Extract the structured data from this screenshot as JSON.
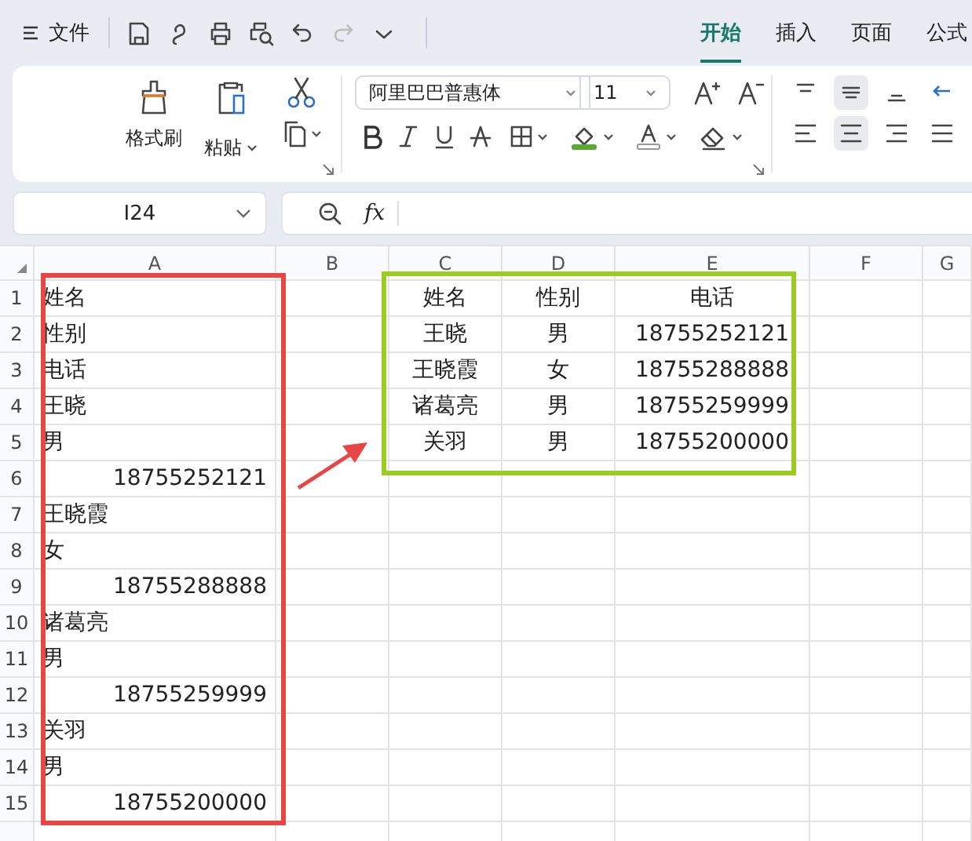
{
  "menu": {
    "label": "文件"
  },
  "tabs": [
    {
      "label": "开始",
      "selected": true
    },
    {
      "label": "插入",
      "selected": false
    },
    {
      "label": "页面",
      "selected": false
    },
    {
      "label": "公式",
      "selected": false
    }
  ],
  "ribbon": {
    "format_painter": "格式刷",
    "paste": "粘贴",
    "font_name": "阿里巴巴普惠体",
    "font_size": "11"
  },
  "formula_bar": {
    "cell_ref": "I24",
    "fx": "fx"
  },
  "sheet": {
    "columns": [
      "A",
      "B",
      "C",
      "D",
      "E",
      "F",
      "G"
    ],
    "rows": [
      {
        "number": "1",
        "cells": [
          "姓名",
          "",
          "姓名",
          "性别",
          "电话",
          "",
          ""
        ]
      },
      {
        "number": "2",
        "cells": [
          "性别",
          "",
          "王晓",
          "男",
          "18755252121",
          "",
          ""
        ]
      },
      {
        "number": "3",
        "cells": [
          "电话",
          "",
          "王晓霞",
          "女",
          "18755288888",
          "",
          ""
        ]
      },
      {
        "number": "4",
        "cells": [
          "王晓",
          "",
          "诸葛亮",
          "男",
          "18755259999",
          "",
          ""
        ]
      },
      {
        "number": "5",
        "cells": [
          "男",
          "",
          "关羽",
          "男",
          "18755200000",
          "",
          ""
        ]
      },
      {
        "number": "6",
        "cells": [
          "18755252121",
          "",
          "",
          "",
          "",
          "",
          ""
        ]
      },
      {
        "number": "7",
        "cells": [
          "王晓霞",
          "",
          "",
          "",
          "",
          "",
          ""
        ]
      },
      {
        "number": "8",
        "cells": [
          "女",
          "",
          "",
          "",
          "",
          "",
          ""
        ]
      },
      {
        "number": "9",
        "cells": [
          "18755288888",
          "",
          "",
          "",
          "",
          "",
          ""
        ]
      },
      {
        "number": "10",
        "cells": [
          "诸葛亮",
          "",
          "",
          "",
          "",
          "",
          ""
        ]
      },
      {
        "number": "11",
        "cells": [
          "男",
          "",
          "",
          "",
          "",
          "",
          ""
        ]
      },
      {
        "number": "12",
        "cells": [
          "18755259999",
          "",
          "",
          "",
          "",
          "",
          ""
        ]
      },
      {
        "number": "13",
        "cells": [
          "关羽",
          "",
          "",
          "",
          "",
          "",
          ""
        ]
      },
      {
        "number": "14",
        "cells": [
          "男",
          "",
          "",
          "",
          "",
          "",
          ""
        ]
      },
      {
        "number": "15",
        "cells": [
          "18755200000",
          "",
          "",
          "",
          "",
          "",
          ""
        ]
      }
    ]
  }
}
